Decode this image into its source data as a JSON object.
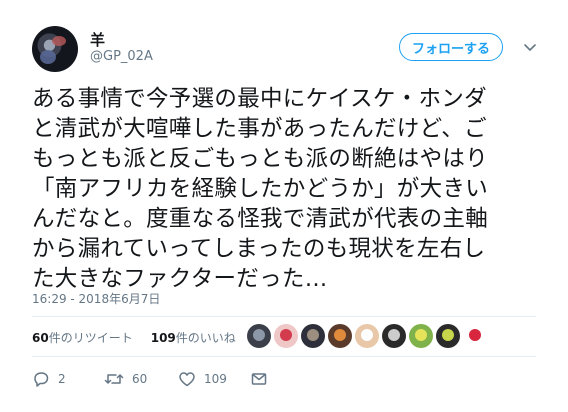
{
  "user": {
    "name": "羊",
    "handle": "@GP_02A"
  },
  "follow_label": "フォローする",
  "tweet": {
    "lines": [
      "ある事情で今予選の最中にケイスケ・ホンダ",
      "と清武が大喧嘩した事があったんだけど、ご",
      "もっとも派と反ごもっとも派の断絶はやはり",
      "「南アフリカを経験したかどうか」が大きい",
      "んだなと。度重なる怪我で清武が代表の主軸",
      "から漏れていってしまったのも現状を左右し",
      "た大きなファクターだった…"
    ],
    "timestamp": "16:29 - 2018年6月7日"
  },
  "stats": {
    "retweets_count": "60",
    "retweets_label": "件のリツイート",
    "likes_count": "109",
    "likes_label": "件のいいね"
  },
  "liker_avatars": [
    {
      "bg": "#3b3f4a",
      "fg": "#8c97a8"
    },
    {
      "bg": "#f0c7c7",
      "fg": "#d23c4c"
    },
    {
      "bg": "#2d2f3a",
      "fg": "#9c8f80"
    },
    {
      "bg": "#5a3a2a",
      "fg": "#e08a3c"
    },
    {
      "bg": "#e8c8a8",
      "fg": "#ffffff"
    },
    {
      "bg": "#2a2a2a",
      "fg": "#cccccc"
    },
    {
      "bg": "#7fb24a",
      "fg": "#e5e35a"
    },
    {
      "bg": "#2a2a2a",
      "fg": "#c7d64a"
    },
    {
      "bg": "#ffffff",
      "fg": "#d7263d"
    }
  ],
  "actions": {
    "replies": "2",
    "retweets": "60",
    "likes": "109"
  },
  "colors": {
    "accent": "#1da1f2",
    "muted": "#657786",
    "text": "#14171a",
    "divider": "#e6ecf0"
  },
  "icons": {
    "caret": "chevron-down-icon",
    "reply": "reply-icon",
    "retweet": "retweet-icon",
    "like": "heart-icon",
    "dm": "envelope-icon"
  }
}
